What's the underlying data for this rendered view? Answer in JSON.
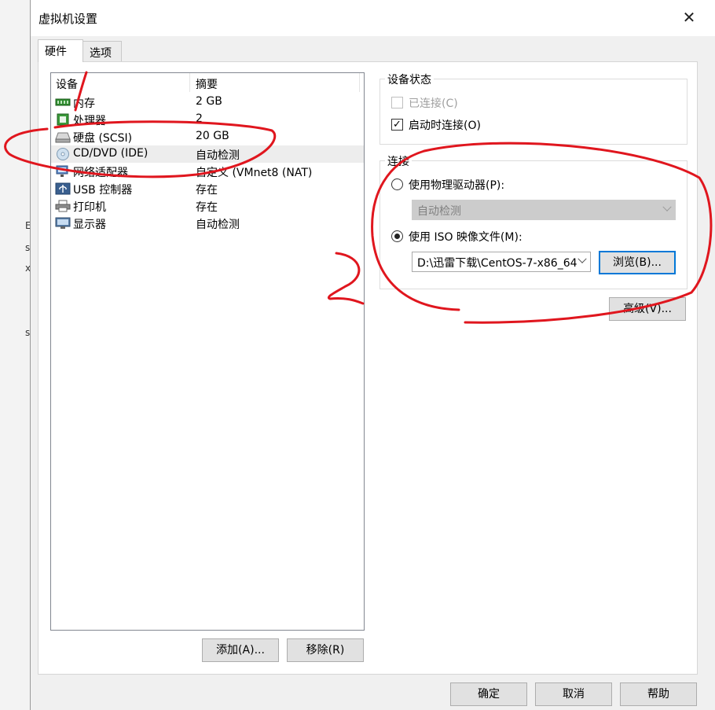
{
  "window": {
    "title": "虚拟机设置"
  },
  "tabs": [
    {
      "label": "硬件"
    },
    {
      "label": "选项"
    }
  ],
  "device_list": {
    "columns": [
      "设备",
      "摘要"
    ],
    "rows": [
      {
        "name": "内存",
        "summary": "2 GB",
        "icon": "memory-icon"
      },
      {
        "name": "处理器",
        "summary": "2",
        "icon": "processor-icon"
      },
      {
        "name": "硬盘 (SCSI)",
        "summary": "20 GB",
        "icon": "hard-disk-icon"
      },
      {
        "name": "CD/DVD (IDE)",
        "summary": "自动检测",
        "icon": "cd-dvd-icon"
      },
      {
        "name": "网络适配器",
        "summary": "自定义 (VMnet8 (NAT)",
        "icon": "network-adapter-icon"
      },
      {
        "name": "USB 控制器",
        "summary": "存在",
        "icon": "usb-icon"
      },
      {
        "name": "打印机",
        "summary": "存在",
        "icon": "printer-icon"
      },
      {
        "name": "显示器",
        "summary": "自动检测",
        "icon": "monitor-icon"
      }
    ]
  },
  "list_buttons": {
    "add": "添加(A)...",
    "remove": "移除(R)"
  },
  "device_status": {
    "title": "设备状态",
    "connected": "已连接(C)",
    "connect_at_power_on": "启动时连接(O)"
  },
  "connection": {
    "title": "连接",
    "physical_drive": "使用物理驱动器(P):",
    "physical_drive_value": "自动检测",
    "iso_file": "使用 ISO 映像文件(M):",
    "iso_path": "D:\\迅雷下载\\CentOS-7-x86_64",
    "browse": "浏览(B)..."
  },
  "advanced_button": "高级(V)...",
  "footer": {
    "ok": "确定",
    "cancel": "取消",
    "help": "帮助"
  },
  "annotations": {
    "mark_1": "1",
    "mark_2": "2"
  },
  "colors": {
    "annotation_red": "#e0161e",
    "focus_blue": "#0078d7",
    "selection": "#ededed"
  }
}
